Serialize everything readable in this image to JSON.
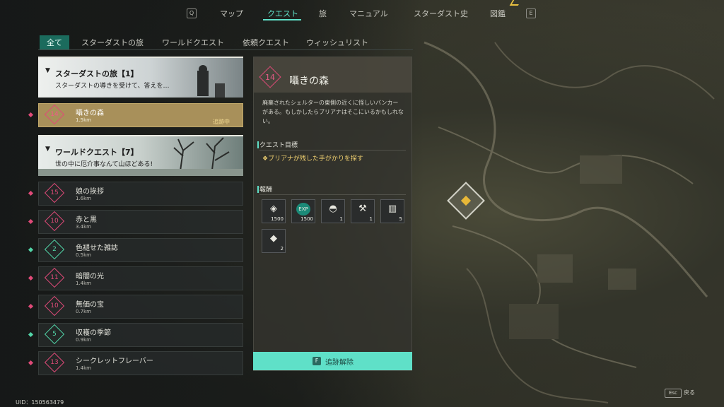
{
  "nav": {
    "left_key": "Q",
    "right_key": "E",
    "items": [
      "マップ",
      "クエスト",
      "旅",
      "マニュアル",
      "スターダスト史",
      "図鑑"
    ],
    "active_index": 1
  },
  "filters": {
    "tabs": [
      "全て",
      "スターダストの旅",
      "ワールドクエスト",
      "依頼クエスト",
      "ウィッシュリスト"
    ],
    "active_index": 0
  },
  "categories": [
    {
      "title": "スターダストの旅【1】",
      "subtitle": "スターダストの導きを受けて、答えを…"
    },
    {
      "title": "ワールドクエスト【7】",
      "subtitle": "世の中に厄介事なんて山ほどある!"
    }
  ],
  "selected_quest": {
    "level": "14",
    "name": "囁きの森",
    "distance": "1.5km",
    "status": "追跡中"
  },
  "quests": [
    {
      "level": "15",
      "name": "娘の挨拶",
      "distance": "1.6km",
      "color": "#e04a78"
    },
    {
      "level": "10",
      "name": "赤と黒",
      "distance": "3.4km",
      "color": "#e04a78"
    },
    {
      "level": "2",
      "name": "色褪せた雑誌",
      "distance": "0.5km",
      "color": "#52d6a8"
    },
    {
      "level": "11",
      "name": "暗闇の光",
      "distance": "1.4km",
      "color": "#e04a78"
    },
    {
      "level": "10",
      "name": "無価の宝",
      "distance": "0.7km",
      "color": "#e04a78"
    },
    {
      "level": "5",
      "name": "収穫の季節",
      "distance": "0.9km",
      "color": "#52d6a8"
    },
    {
      "level": "13",
      "name": "シークレットフレーバー",
      "distance": "1.4km",
      "color": "#e04a78"
    }
  ],
  "detail": {
    "level": "14",
    "title": "囁きの森",
    "description": "廃棄されたシェルターの東側の近くに怪しいバンカーがある。もしかしたらブリアナはそこにいるかもしれない。",
    "objective_header": "クエスト目標",
    "objective": "ブリアナが残した手がかりを探す",
    "rewards_header": "報酬",
    "rewards": [
      {
        "icon": "target-chip-icon",
        "glyph": "◈",
        "count": "1500"
      },
      {
        "icon": "exp-icon",
        "glyph": "EXP",
        "count": "1500"
      },
      {
        "icon": "cap-icon",
        "glyph": "◓",
        "count": "1"
      },
      {
        "icon": "wrench-icon",
        "glyph": "⚒",
        "count": "1"
      },
      {
        "icon": "canister-icon",
        "glyph": "▥",
        "count": "5"
      },
      {
        "icon": "crystal-icon",
        "glyph": "◆",
        "count": "2"
      }
    ],
    "untrack_key": "F",
    "untrack_label": "追跡解除"
  },
  "footer": {
    "uid": "UID：150563479",
    "back_key": "Esc",
    "back_label": "戻る"
  }
}
